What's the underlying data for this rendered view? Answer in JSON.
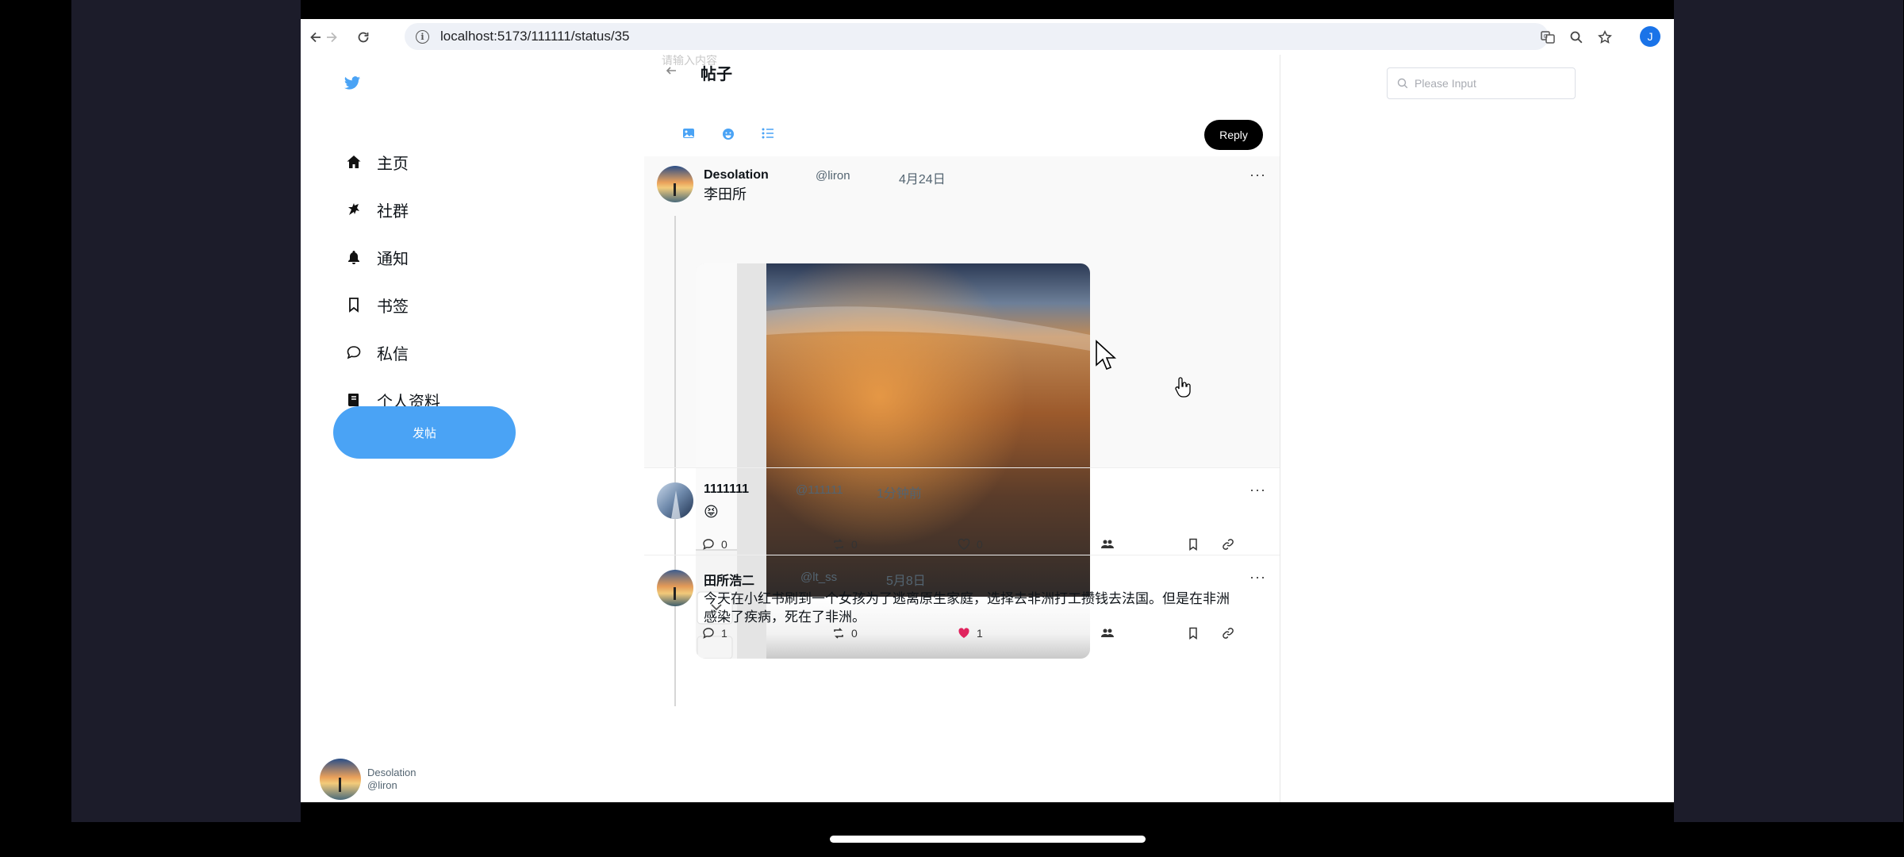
{
  "browser": {
    "url": "localhost:5173/111111/status/35",
    "profile_initial": "J"
  },
  "nav": {
    "items": [
      {
        "label": "主页",
        "icon": "home-icon"
      },
      {
        "label": "社群",
        "icon": "community-icon"
      },
      {
        "label": "通知",
        "icon": "bell-icon"
      },
      {
        "label": "书签",
        "icon": "bookmark-icon"
      },
      {
        "label": "私信",
        "icon": "message-icon"
      },
      {
        "label": "个人资料",
        "icon": "profile-book-icon"
      }
    ],
    "post_button": "发帖",
    "user": {
      "name": "Desolation",
      "handle": "@liron"
    }
  },
  "feed": {
    "faint_text": "请输入内容",
    "title": "帖子",
    "reply_button": "Reply"
  },
  "search": {
    "placeholder": "Please Input"
  },
  "posts": [
    {
      "name": "Desolation",
      "handle": "@liron",
      "time": "4月24日",
      "text": "李田所",
      "replies": "1",
      "reposts": "0",
      "likes": "1",
      "liked": true
    },
    {
      "name": "1111111",
      "handle": "@111111",
      "time": "1分钟前",
      "text": "😝",
      "replies": "0",
      "reposts": "0",
      "likes": "0",
      "liked": false
    },
    {
      "name": "田所浩二",
      "handle": "@lt_ss",
      "time": "5月8日",
      "text_line1": "今天在小红书刷到一个女孩为了逃离原生家庭，选择去非洲打工攒钱去法国。但是在非洲",
      "text_line2": "感染了疾病，死在了非洲。"
    }
  ],
  "colors": {
    "accent": "#4aa3f5",
    "like_red": "#e0245e",
    "side_band": "#1c1c2a"
  }
}
